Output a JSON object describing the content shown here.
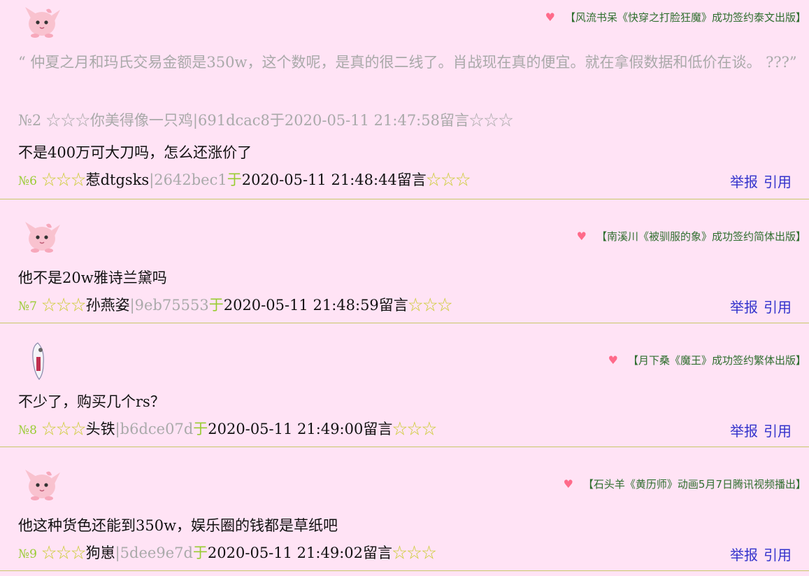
{
  "posts": [
    {
      "badge": "【风流书呆《快穿之打脸狂魔》成功签约泰文出版】",
      "quote": "“ 仲夏之月和玛氏交易金额是350w，这个数呢，是真的很二线了。肖战现在真的便宜。就在拿假数据和低价在谈。 ???”",
      "quote_meta": "№2 ☆☆☆你美得像一只鸡|691dcac8于2020-05-11 21:47:58留言☆☆☆",
      "content": "不是400万可大刀吗，怎么还涨价了",
      "num": "№6",
      "stars": "☆☆☆",
      "user": "惹dtgsks",
      "hash": "|2642bec1",
      "yu": "于",
      "time": "2020-05-11 21:48:44留言",
      "report": "举报",
      "cite": "引用",
      "avatar": "pink-creature"
    },
    {
      "badge": "【南溪川《被驯服的象》成功签约简体出版】",
      "content": "他不是20w雅诗兰黛吗",
      "num": "№7",
      "stars": "☆☆☆",
      "user": "孙燕姿",
      "hash": "|9eb75553",
      "yu": "于",
      "time": "2020-05-11 21:48:59留言",
      "report": "举报",
      "cite": "引用",
      "avatar": "pink-creature"
    },
    {
      "badge": "【月下桑《魔王》成功签约繁体出版】",
      "content": "不少了，购买几个rs？",
      "num": "№8",
      "stars": "☆☆☆",
      "user": "头铁",
      "hash": "|b6dce07d",
      "yu": "于",
      "time": "2020-05-11 21:49:00留言",
      "report": "举报",
      "cite": "引用",
      "avatar": "white-figure"
    },
    {
      "badge": "【石头羊《黄历师》动画5月7日腾讯视频播出】",
      "content": "他这种货色还能到350w，娱乐圈的钱都是草纸吧",
      "num": "№9",
      "stars": "☆☆☆",
      "user": "狗崽",
      "hash": "|5dee9e7d",
      "yu": "于",
      "time": "2020-05-11 21:49:02留言",
      "report": "举报",
      "cite": "引用",
      "avatar": "pink-creature"
    }
  ],
  "colors": {
    "background": "#ffe3f5",
    "divider": "#c8c86a",
    "link": "#3333cc",
    "badge": "#2e6e2e",
    "heart": "#ff6a8a",
    "number": "#99cc33",
    "quote": "#a9a9a9"
  }
}
